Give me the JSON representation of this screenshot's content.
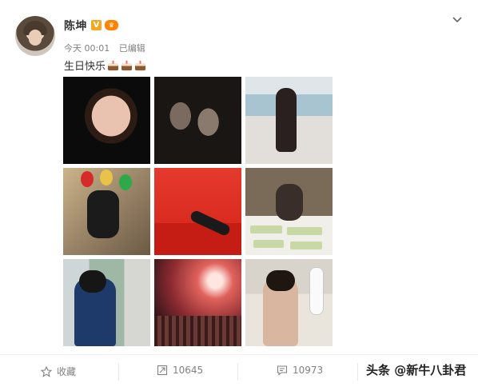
{
  "post": {
    "author": "陈坤",
    "verified_badge": "V",
    "timestamp": "今天 00:01",
    "edited": "已编辑",
    "text": "生日快乐"
  },
  "actions": {
    "favorite_label": "收藏",
    "repost_count": "10645",
    "comment_count": "10973"
  },
  "watermark": "头条 @新牛八卦君",
  "colors": {
    "verified": "#f5a623",
    "text_meta": "#808080",
    "author": "#333333"
  },
  "icons": [
    "chevron-down-icon",
    "cake-icon",
    "star-icon",
    "repost-icon",
    "comment-icon"
  ]
}
